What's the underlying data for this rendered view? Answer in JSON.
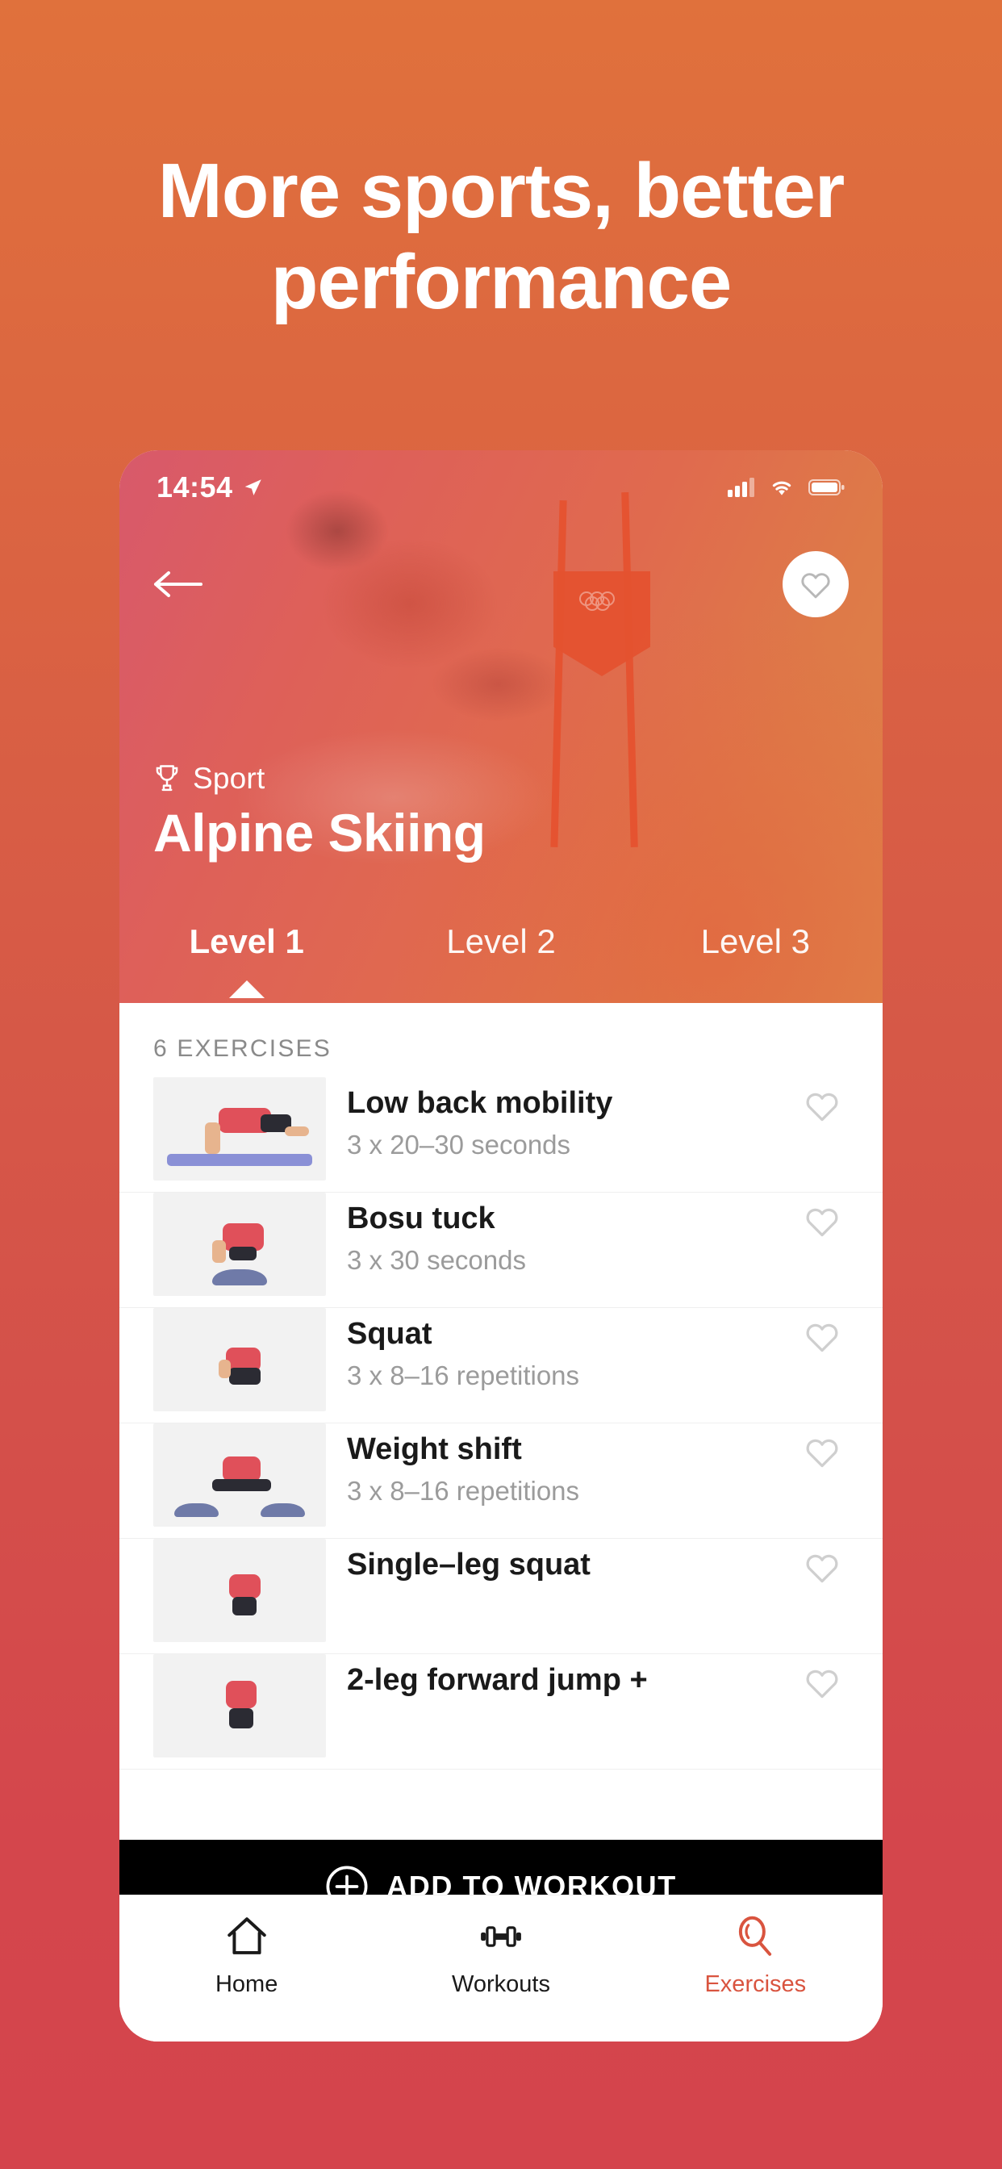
{
  "hero": {
    "line1": "More sports, better",
    "line2": "performance"
  },
  "status_bar": {
    "time": "14:54",
    "location_icon": "location-arrow-icon",
    "signal_icon": "cellular-signal-icon",
    "wifi_icon": "wifi-icon",
    "battery_icon": "battery-icon"
  },
  "header": {
    "back_icon": "back-arrow-icon",
    "favorite_icon": "heart-outline-icon",
    "kicker_icon": "trophy-icon",
    "kicker": "Sport",
    "title": "Alpine Skiing"
  },
  "tabs": [
    {
      "label": "Level 1",
      "active": true
    },
    {
      "label": "Level 2",
      "active": false
    },
    {
      "label": "Level 3",
      "active": false
    }
  ],
  "list": {
    "count_label": "6 EXERCISES",
    "items": [
      {
        "name": "Low back mobility",
        "meta": "3 x 20–30 seconds",
        "heart_icon": "heart-outline-icon"
      },
      {
        "name": "Bosu tuck",
        "meta": "3 x 30 seconds",
        "heart_icon": "heart-outline-icon"
      },
      {
        "name": "Squat",
        "meta": "3 x 8–16 repetitions",
        "heart_icon": "heart-outline-icon"
      },
      {
        "name": "Weight shift",
        "meta": "3 x 8–16 repetitions",
        "heart_icon": "heart-outline-icon"
      },
      {
        "name": "Single–leg squat",
        "meta": "",
        "heart_icon": "heart-outline-icon"
      },
      {
        "name": "2-leg forward jump +",
        "meta": "",
        "heart_icon": "heart-outline-icon"
      }
    ]
  },
  "add_bar": {
    "icon": "plus-circle-icon",
    "label": "ADD TO WORKOUT"
  },
  "bottom_nav": [
    {
      "label": "Home",
      "icon": "home-icon",
      "active": false
    },
    {
      "label": "Workouts",
      "icon": "dumbbell-icon",
      "active": false
    },
    {
      "label": "Exercises",
      "icon": "search-magnifier-icon",
      "active": true
    }
  ],
  "colors": {
    "bg_top": "#E0713C",
    "bg_bottom": "#D4444C",
    "accent": "#D9543F",
    "add_bar_bg": "#000000",
    "text_primary": "#1A1A1A",
    "text_muted": "#9B9B9B"
  }
}
